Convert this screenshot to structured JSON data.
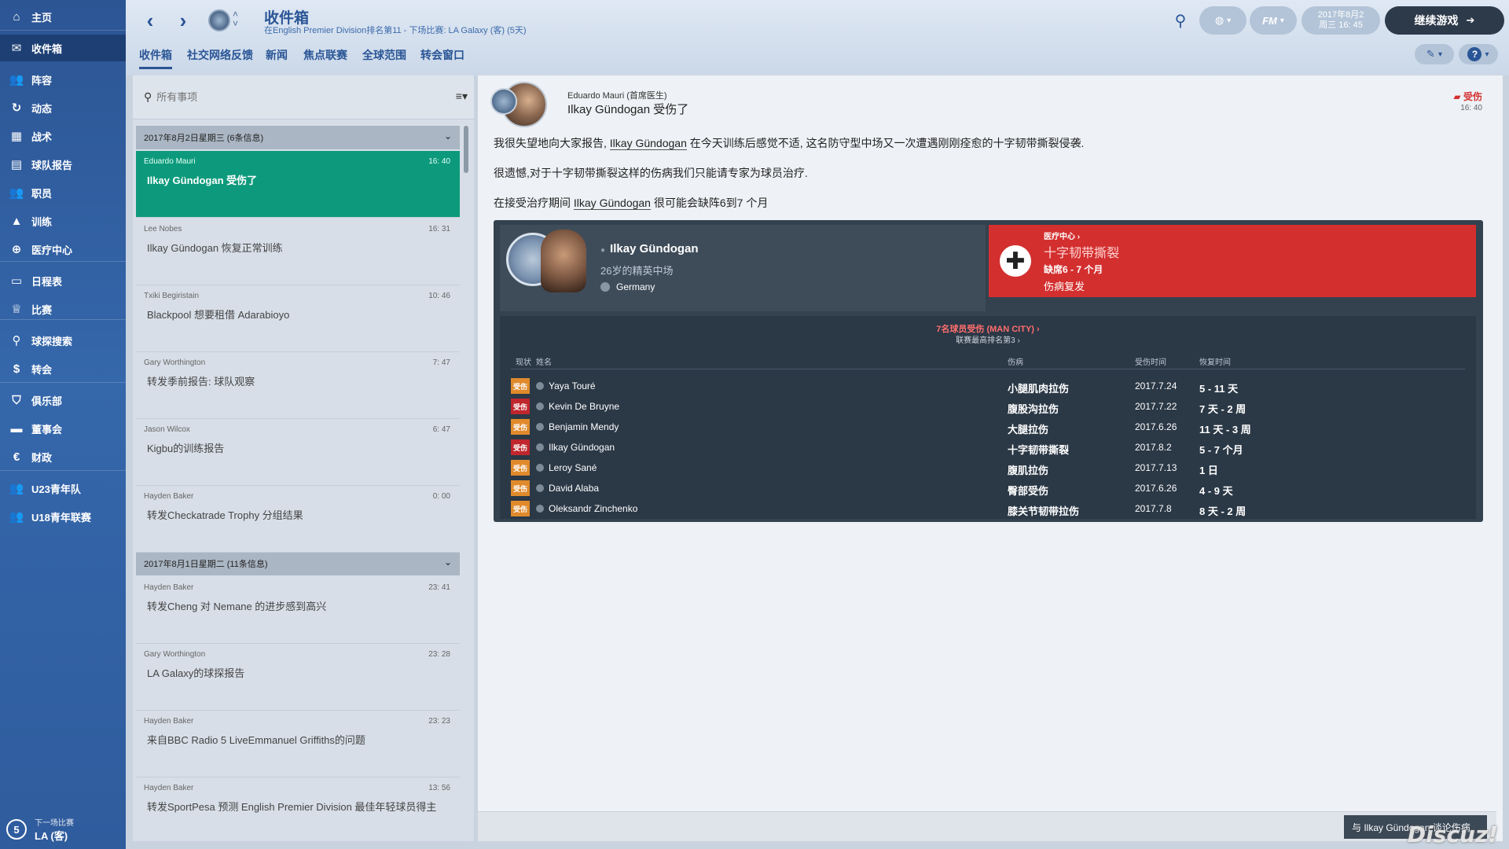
{
  "sidebar": {
    "items": [
      {
        "label": "主页",
        "icon": "home-icon",
        "glyph": "⌂"
      },
      {
        "label": "收件箱",
        "icon": "inbox-icon",
        "glyph": "✉"
      },
      {
        "label": "阵容",
        "icon": "squad-icon",
        "glyph": "👥"
      },
      {
        "label": "动态",
        "icon": "dynamics-icon",
        "glyph": "↻"
      },
      {
        "label": "战术",
        "icon": "tactics-icon",
        "glyph": "▦"
      },
      {
        "label": "球队报告",
        "icon": "team-report-icon",
        "glyph": "▤"
      },
      {
        "label": "职员",
        "icon": "staff-icon",
        "glyph": "👥"
      },
      {
        "label": "训练",
        "icon": "training-icon",
        "glyph": "▲"
      },
      {
        "label": "医疗中心",
        "icon": "medical-icon",
        "glyph": "⊕"
      },
      {
        "label": "日程表",
        "icon": "schedule-icon",
        "glyph": "▭"
      },
      {
        "label": "比赛",
        "icon": "trophy-icon",
        "glyph": "♕"
      },
      {
        "label": "球探搜索",
        "icon": "scouting-icon",
        "glyph": "⚲"
      },
      {
        "label": "转会",
        "icon": "transfer-icon",
        "glyph": "$"
      },
      {
        "label": "俱乐部",
        "icon": "club-icon",
        "glyph": "⛉"
      },
      {
        "label": "董事会",
        "icon": "board-icon",
        "glyph": "▬"
      },
      {
        "label": "财政",
        "icon": "finance-icon",
        "glyph": "€"
      },
      {
        "label": "U23青年队",
        "icon": "u23-icon",
        "glyph": "👥"
      },
      {
        "label": "U18青年联赛",
        "icon": "u18-icon",
        "glyph": "👥"
      }
    ],
    "next_match_label": "下一场比赛",
    "next_match_team": "LA (客)",
    "next_match_days": "5"
  },
  "header": {
    "title": "收件箱",
    "subtitle": "在English Premier Division排名第11 - 下场比赛: LA Galaxy (客) (5天)",
    "tabs": [
      "收件箱",
      "社交网络反馈",
      "新闻",
      "焦点联赛",
      "全球范围",
      "转会窗口"
    ],
    "date_line1": "2017年8月2",
    "date_line2": "周三 16: 45",
    "fm_label": "FM",
    "continue_label": "继续游戏"
  },
  "list": {
    "search_placeholder": "所有事项",
    "groups": [
      {
        "title": "2017年8月2日星期三 (6条信息)"
      },
      {
        "title": "2017年8月1日星期二 (11条信息)"
      }
    ],
    "messages": [
      {
        "sender": "Eduardo Mauri",
        "time": "16: 40",
        "subject": "Ilkay Gündogan 受伤了"
      },
      {
        "sender": "Lee Nobes",
        "time": "16: 31",
        "subject": "Ilkay Gündogan 恢复正常训练"
      },
      {
        "sender": "Txiki Begiristain",
        "time": "10: 46",
        "subject": "Blackpool 想要租借 Adarabioyo"
      },
      {
        "sender": "Gary Worthington",
        "time": "7: 47",
        "subject": "转发季前报告: 球队观察"
      },
      {
        "sender": "Jason Wilcox",
        "time": "6: 47",
        "subject": "Kigbu的训练报告"
      },
      {
        "sender": "Hayden Baker",
        "time": "0: 00",
        "subject": "转发Checkatrade Trophy 分组结果"
      },
      {
        "sender": "Hayden Baker",
        "time": "23: 41",
        "subject": "转发Cheng 对 Nemane 的进步感到高兴"
      },
      {
        "sender": "Gary Worthington",
        "time": "23: 28",
        "subject": "LA Galaxy的球探报告"
      },
      {
        "sender": "Hayden Baker",
        "time": "23: 23",
        "subject": "来自BBC Radio 5 LiveEmmanuel Griffiths的问题"
      },
      {
        "sender": "Hayden Baker",
        "time": "13: 56",
        "subject": "转发SportPesa 预测 English Premier Division 最佳年轻球员得主"
      }
    ]
  },
  "detail": {
    "from_name": "Eduardo Mauri (首席医生)",
    "subject": "Ilkay Gündogan 受伤了",
    "tag": "受伤",
    "time": "16: 40",
    "line1_a": "我很失望地向大家报告,",
    "line1_link": "Ilkay Gündogan",
    "line1_b": "在今天训练后感觉不适, 这名防守型中场又一次遭遇刚刚痊愈的十字韧带撕裂侵袭.",
    "line2": "很遗憾,对于十字韧带撕裂这样的伤病我们只能请专家为球员治疗.",
    "line3_a": "在接受治疗期间",
    "line3_link": "Ilkay Gündogan",
    "line3_b": "很可能会缺阵6到7 个月",
    "player": {
      "name": "Ilkay Gündogan",
      "desc": "26岁的精英中场",
      "nation": "Germany"
    },
    "medical": {
      "link": "医疗中心 ›",
      "injury": "十字韧带撕裂",
      "out": "缺席6 - 7 个月",
      "recur": "伤病复发"
    },
    "table": {
      "title": "7名球员受伤 (MAN CITY) ›",
      "subtitle": "联赛最高排名第3 ›",
      "headers": {
        "status": "现状",
        "name": "姓名",
        "injury": "伤病",
        "date": "受伤时间",
        "recovery": "恢复时间"
      },
      "rows": [
        {
          "status": "受伤",
          "severity": "minor",
          "name": "Yaya Touré",
          "injury": "小腿肌肉拉伤",
          "date": "2017.7.24",
          "recovery": "5 - 11 天"
        },
        {
          "status": "受伤",
          "severity": "major",
          "name": "Kevin De Bruyne",
          "injury": "腹股沟拉伤",
          "date": "2017.7.22",
          "recovery": "7 天 - 2 周"
        },
        {
          "status": "受伤",
          "severity": "minor",
          "name": "Benjamin Mendy",
          "injury": "大腿拉伤",
          "date": "2017.6.26",
          "recovery": "11 天 - 3 周"
        },
        {
          "status": "受伤",
          "severity": "major",
          "name": "Ilkay Gündogan",
          "injury": "十字韧带撕裂",
          "date": "2017.8.2",
          "recovery": "5 - 7 个月"
        },
        {
          "status": "受伤",
          "severity": "minor",
          "name": "Leroy Sané",
          "injury": "腹肌拉伤",
          "date": "2017.7.13",
          "recovery": "1 日"
        },
        {
          "status": "受伤",
          "severity": "minor",
          "name": "David Alaba",
          "injury": "臀部受伤",
          "date": "2017.6.26",
          "recovery": "4 - 9 天"
        },
        {
          "status": "受伤",
          "severity": "minor",
          "name": "Oleksandr Zinchenko",
          "injury": "膝关节韧带拉伤",
          "date": "2017.7.8",
          "recovery": "8 天 - 2 周"
        }
      ]
    },
    "reply_label": "与 Ilkay Gündogan 谈论伤病"
  },
  "colors": {
    "accent": "#2a5596",
    "selected": "#0d9a7c",
    "injury_red": "#d32f2f",
    "minor_orange": "#e08a2c",
    "major_red": "#c0262d"
  },
  "watermark": "Discuz!"
}
